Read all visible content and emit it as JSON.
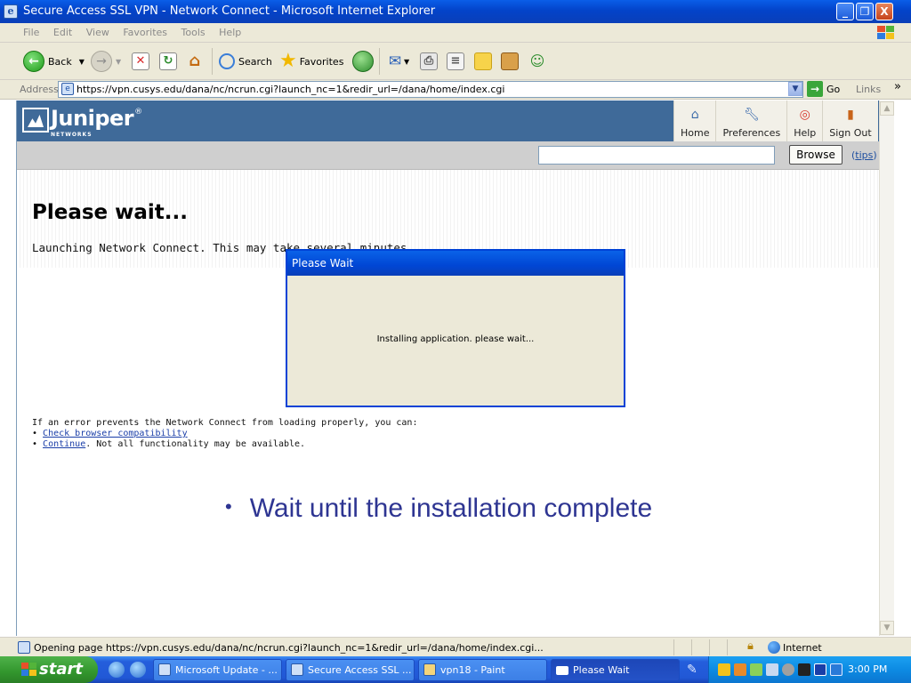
{
  "window": {
    "title": "Secure Access SSL VPN - Network Connect - Microsoft Internet Explorer",
    "minimize": "_",
    "restore": "❐",
    "close": "X"
  },
  "menu": [
    "File",
    "Edit",
    "View",
    "Favorites",
    "Tools",
    "Help"
  ],
  "toolbar": {
    "back_label": "Back",
    "search_label": "Search",
    "favorites_label": "Favorites"
  },
  "address": {
    "label": "Address",
    "url": "https://vpn.cusys.edu/dana/nc/ncrun.cgi?launch_nc=1&redir_url=/dana/home/index.cgi",
    "go_label": "Go",
    "links_label": "Links"
  },
  "portal": {
    "brand": "Juniper",
    "brand_sub": "NETWORKS",
    "nav": [
      {
        "label": "Home",
        "icon": "home-icon"
      },
      {
        "label": "Preferences",
        "icon": "wrench-icon"
      },
      {
        "label": "Help",
        "icon": "lifebuoy-icon"
      },
      {
        "label": "Sign Out",
        "icon": "door-icon"
      }
    ],
    "browse_label": "Browse",
    "tips_label": "tips"
  },
  "page": {
    "heading": "Please wait...",
    "message": "Launching Network Connect. This may take several minutes.",
    "error_intro": "If an error prevents the Network Connect from loading properly, you can:",
    "error_options": [
      {
        "link": "Check browser compatibility",
        "suffix": ""
      },
      {
        "link": "Continue",
        "suffix": ". Not all functionality may be available."
      }
    ]
  },
  "dialog": {
    "title": "Please Wait",
    "message": "Installing application. please wait..."
  },
  "annotation": "Wait until the installation complete",
  "statusbar": {
    "text": "Opening page https://vpn.cusys.edu/dana/nc/ncrun.cgi?launch_nc=1&redir_url=/dana/home/index.cgi...",
    "zone": "Internet"
  },
  "taskbar": {
    "start_label": "start",
    "tasks": [
      {
        "label": "Microsoft Update - ..."
      },
      {
        "label": "Secure Access SSL ..."
      },
      {
        "label": "vpn18 - Paint"
      },
      {
        "label": "Please Wait"
      }
    ],
    "clock": "3:00 PM"
  },
  "colors": {
    "titlebar": "#0343c9",
    "portal_header": "#3f6a99",
    "annotation_text": "#2e3592",
    "link": "#1a3ea8"
  }
}
